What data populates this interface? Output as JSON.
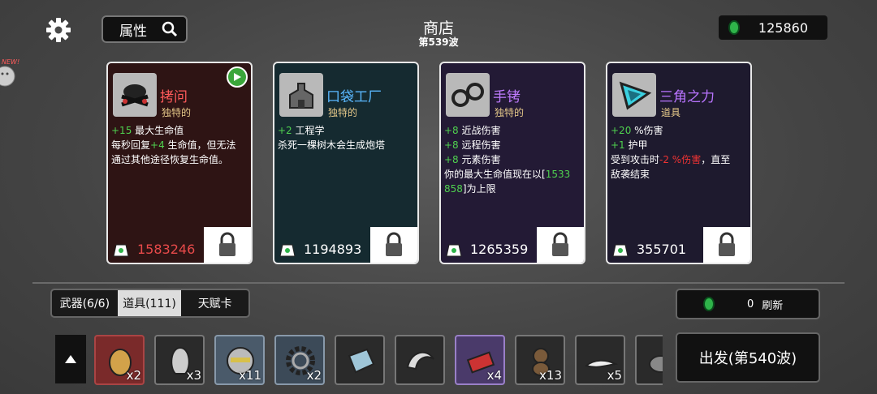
{
  "header": {
    "shop_title": "商店",
    "wave_label": "第539波",
    "attr_button": "属性",
    "money": "125860"
  },
  "cards": [
    {
      "name": "拷问",
      "rarity": "独特的",
      "price": "1583246",
      "icon": "torture-icon",
      "desc": [
        {
          "g": "+15",
          "t": " 最大生命值"
        },
        {
          "t": "每秒回复"
        },
        {
          "g": "+4",
          "t": " 生命值，但无法"
        },
        {
          "t": "通过其他途径恢复生命值。"
        }
      ]
    },
    {
      "name": "口袋工厂",
      "rarity": "独特的",
      "price": "1194893",
      "icon": "factory-icon",
      "desc": [
        {
          "g": "+2",
          "t": " 工程学"
        },
        {
          "t": "杀死一棵树木会生成炮塔"
        }
      ]
    },
    {
      "name": "手铐",
      "rarity": "独特的",
      "price": "1265359",
      "icon": "handcuffs-icon",
      "desc": [
        {
          "g": "+8",
          "t": " 近战伤害"
        },
        {
          "g": "+8",
          "t": " 远程伤害"
        },
        {
          "g": "+8",
          "t": " 元素伤害"
        },
        {
          "t": "你的最大生命值现在以["
        },
        {
          "g": "1533"
        },
        {
          "g": "858",
          "t": "]为上限"
        }
      ]
    },
    {
      "name": "三角之力",
      "rarity": "道具",
      "price": "355701",
      "icon": "triangle-icon",
      "desc": [
        {
          "g": "+20",
          "t": " %伤害"
        },
        {
          "g": "+1",
          "t": " 护甲"
        },
        {
          "t": "受到攻击时",
          "r": "-2 %伤害",
          "t2": "，直至"
        },
        {
          "t": "敌袭结束"
        }
      ]
    }
  ],
  "tabs": [
    "武器(6/6)",
    "道具(111)",
    "天赋卡"
  ],
  "refresh": {
    "count": "0",
    "label": "刷新"
  },
  "go_button": "出发(第540波)",
  "inventory": [
    {
      "icon": "potato-icon",
      "count": "x2"
    },
    {
      "icon": "alien-icon",
      "count": "x3"
    },
    {
      "icon": "helmet-icon",
      "count": "x11"
    },
    {
      "icon": "gear-icon",
      "count": "x2"
    },
    {
      "icon": "book-icon",
      "count": ""
    },
    {
      "icon": "claw-icon",
      "count": ""
    },
    {
      "icon": "toolbox-icon",
      "count": "x4"
    },
    {
      "icon": "monkey-icon",
      "count": "x13"
    },
    {
      "icon": "lizard-icon",
      "count": "x5"
    },
    {
      "icon": "bowl-icon",
      "count": ""
    }
  ],
  "colors": {
    "price_red": "#e84a4a",
    "green": "#4fd14f",
    "name_red": "#ff5a5a",
    "name_blue": "#5ab8ff",
    "name_purple": "#c07bff",
    "name_purple2": "#b974ff"
  }
}
